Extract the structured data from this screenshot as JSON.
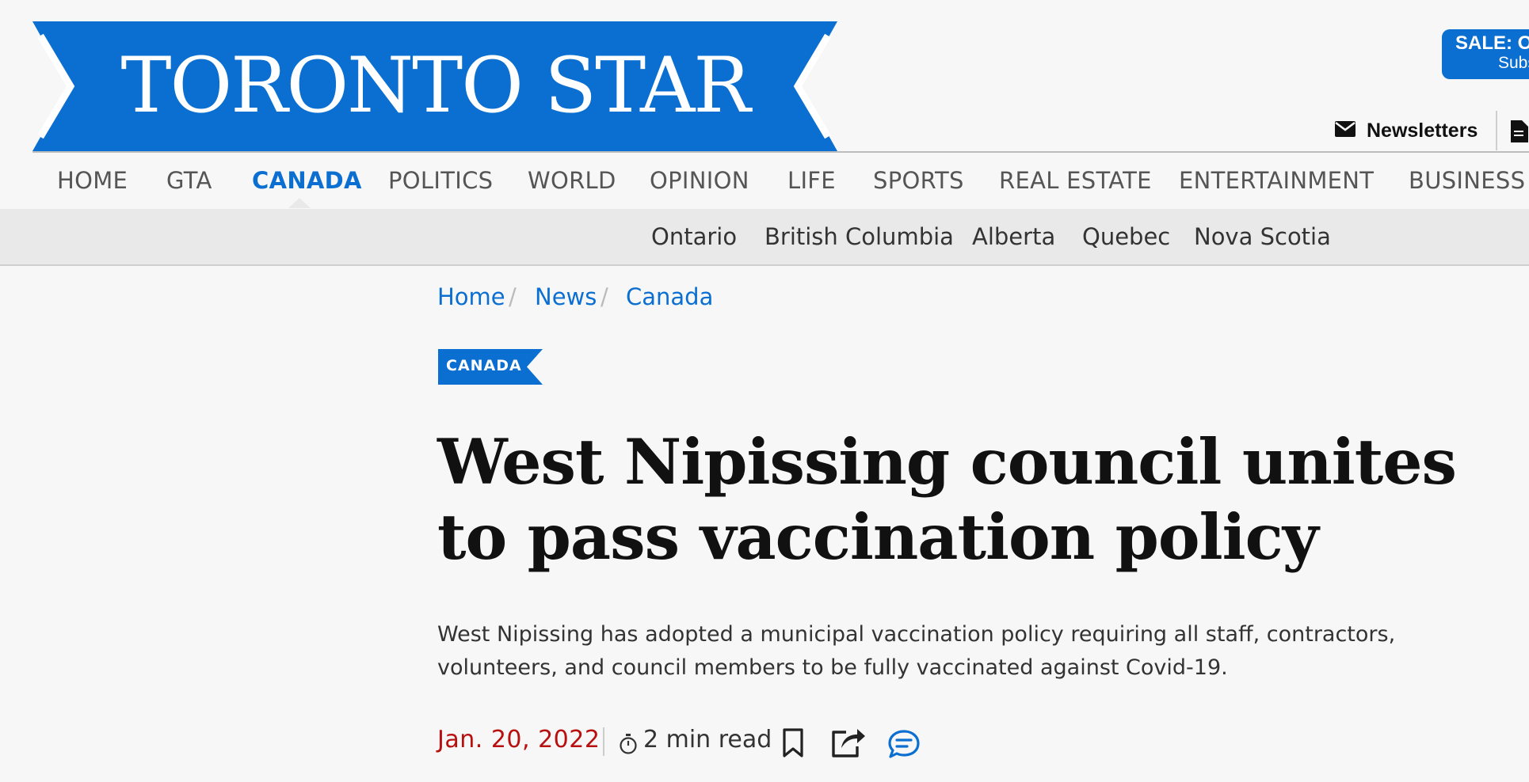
{
  "brand": {
    "name": "TORONTO STAR",
    "color": "#0b6fd1"
  },
  "header": {
    "sale_line1": "SALE: Or",
    "sale_line2": "Subs",
    "newsletters_label": "Newsletters"
  },
  "nav": {
    "items": [
      "HOME",
      "GTA",
      "CANADA",
      "POLITICS",
      "WORLD",
      "OPINION",
      "LIFE",
      "SPORTS",
      "REAL ESTATE",
      "ENTERTAINMENT",
      "BUSINESS"
    ],
    "active": "CANADA"
  },
  "subnav": {
    "items": [
      "Ontario",
      "British Columbia",
      "Alberta",
      "Quebec",
      "Nova Scotia"
    ]
  },
  "breadcrumb": {
    "items": [
      "Home",
      "News",
      "Canada"
    ],
    "separator": "/"
  },
  "article": {
    "section_tag": "CANADA",
    "headline": "West Nipissing council unites to pass vaccination policy",
    "summary": "West Nipissing has adopted a municipal vaccination policy requiring all staff, contractors, volunteers, and council members to be fully vaccinated against Covid-19.",
    "date": "Jan. 20, 2022",
    "read_time": "2 min read"
  },
  "icons": {
    "newsletters": "envelope-icon",
    "document": "document-icon",
    "timer": "stopwatch-icon",
    "bookmark": "bookmark-icon",
    "share": "share-icon",
    "comment": "comment-icon"
  },
  "colors": {
    "accent": "#0b6fd1",
    "date": "#b80f0f",
    "subnav_bg": "#e9e9e9",
    "page_bg": "#f7f7f7"
  }
}
